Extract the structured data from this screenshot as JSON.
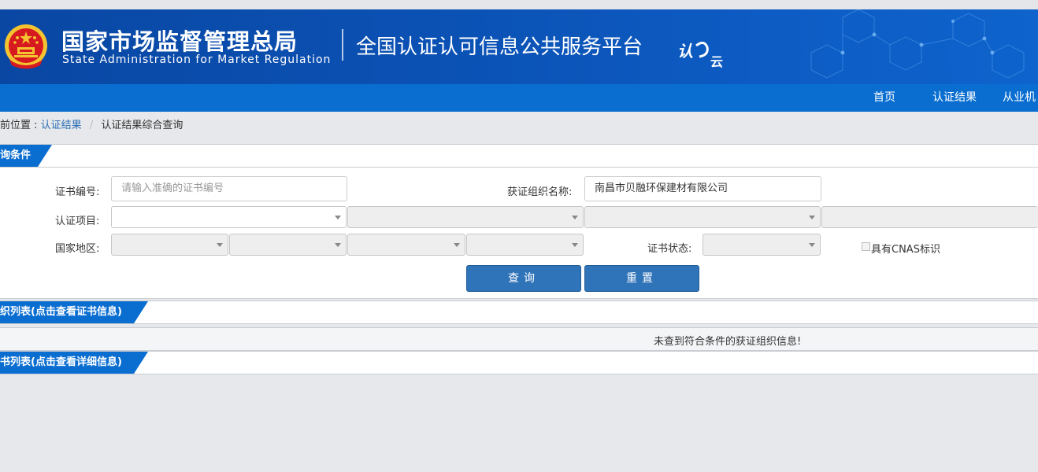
{
  "header": {
    "agency_cn": "国家市场监督管理总局",
    "agency_en": "State Administration  for  Market Regulation",
    "platform_title": "全国认证认可信息公共服务平台",
    "emblem_icon": "national-emblem-icon",
    "logo_icon": "renyun-logo-icon",
    "colors": {
      "banner": "#0b52b5",
      "nav": "#0a6ed1",
      "accent_red": "#d71920",
      "gold": "#f4c430"
    }
  },
  "nav": {
    "items": [
      {
        "label": "首页"
      },
      {
        "label": "认证结果"
      },
      {
        "label": "从业机"
      }
    ]
  },
  "breadcrumb": {
    "prefix": "前位置 :",
    "link": "认证结果",
    "current": "认证结果综合查询",
    "separator": "/"
  },
  "query_section": {
    "title": "询条件",
    "cert_no_label": "证书编号:",
    "cert_no_placeholder": "请输入准确的证书编号",
    "org_name_label": "获证组织名称:",
    "org_name_value": "南昌市贝融环保建材有限公司",
    "project_label": "认证项目:",
    "region_label": "国家地区:",
    "status_label": "证书状态:",
    "cnas_label": "具有CNAS标识",
    "search_button": "查询",
    "reset_button": "重置"
  },
  "org_list_section": {
    "title": "织列表(点击查看证书信息)",
    "empty_message": "未查到符合条件的获证组织信息!"
  },
  "cert_list_section": {
    "title": "书列表(点击查看详细信息)"
  }
}
